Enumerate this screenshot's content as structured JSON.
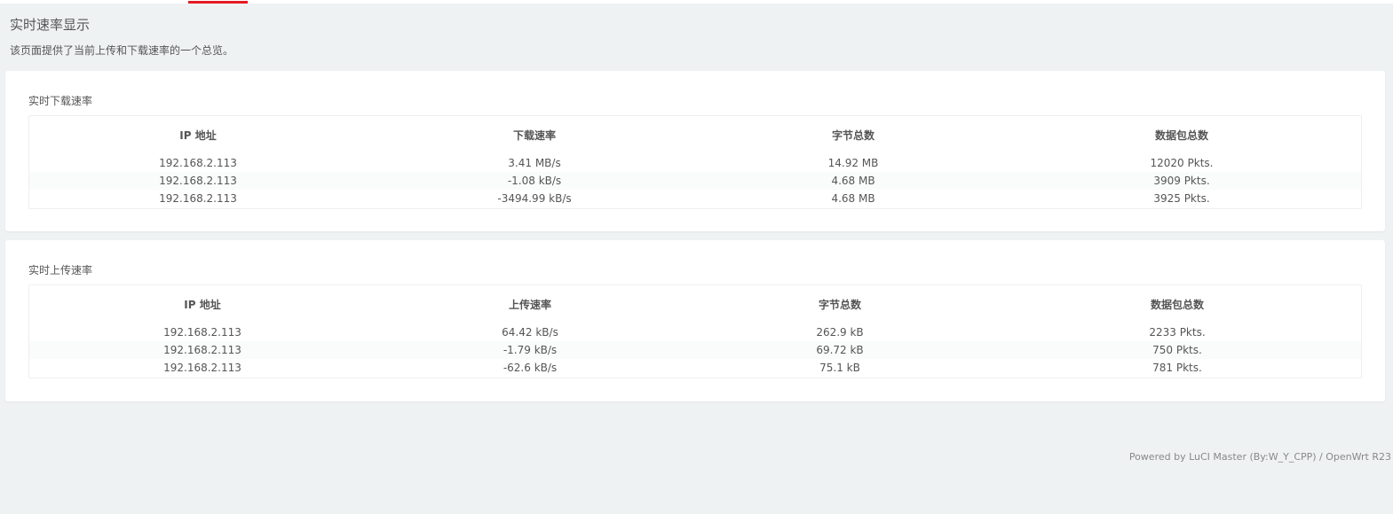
{
  "page": {
    "title": "实时速率显示",
    "description": "该页面提供了当前上传和下载速率的一个总览。"
  },
  "download": {
    "title": "实时下载速率",
    "headers": [
      "IP 地址",
      "下载速率",
      "字节总数",
      "数据包总数"
    ],
    "rows": [
      [
        "192.168.2.113",
        "3.41 MB/s",
        "14.92 MB",
        "12020 Pkts."
      ],
      [
        "192.168.2.113",
        "-1.08 kB/s",
        "4.68 MB",
        "3909 Pkts."
      ],
      [
        "192.168.2.113",
        "-3494.99 kB/s",
        "4.68 MB",
        "3925 Pkts."
      ]
    ]
  },
  "upload": {
    "title": "实时上传速率",
    "headers": [
      "IP 地址",
      "上传速率",
      "字节总数",
      "数据包总数"
    ],
    "rows": [
      [
        "192.168.2.113",
        "64.42 kB/s",
        "262.9 kB",
        "2233 Pkts."
      ],
      [
        "192.168.2.113",
        "-1.79 kB/s",
        "69.72 kB",
        "750 Pkts."
      ],
      [
        "192.168.2.113",
        "-62.6 kB/s",
        "75.1 kB",
        "781 Pkts."
      ]
    ]
  },
  "footer": {
    "text": "Powered by LuCI Master (By:W_Y_CPP) / OpenWrt R23"
  },
  "colors": {
    "accent": "#e51c23",
    "background": "#eff2f3"
  }
}
